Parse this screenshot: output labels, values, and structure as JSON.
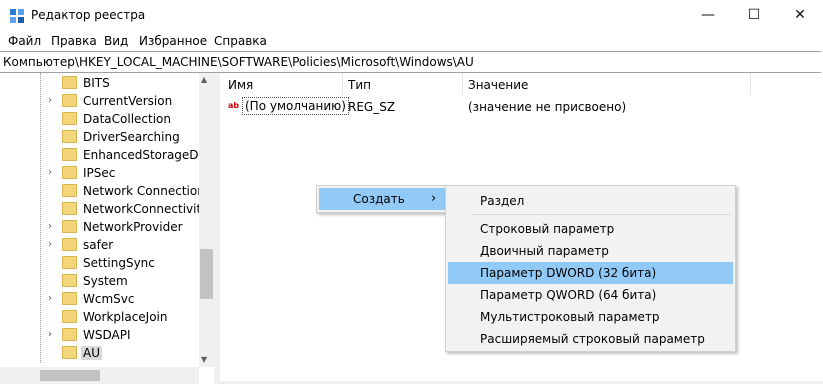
{
  "window": {
    "title": "Редактор реестра",
    "controls": {
      "minimize": "—",
      "maximize": "☐",
      "close": "✕"
    }
  },
  "menu": [
    "Файл",
    "Правка",
    "Вид",
    "Избранное",
    "Справка"
  ],
  "address": "Компьютер\\HKEY_LOCAL_MACHINE\\SOFTWARE\\Policies\\Microsoft\\Windows\\AU",
  "tree": [
    {
      "label": "BITS",
      "expandable": false
    },
    {
      "label": "CurrentVersion",
      "expandable": true
    },
    {
      "label": "DataCollection",
      "expandable": false
    },
    {
      "label": "DriverSearching",
      "expandable": false
    },
    {
      "label": "EnhancedStorageDevi",
      "expandable": false
    },
    {
      "label": "IPSec",
      "expandable": true
    },
    {
      "label": "Network Connections",
      "expandable": false
    },
    {
      "label": "NetworkConnectivityS",
      "expandable": false
    },
    {
      "label": "NetworkProvider",
      "expandable": true
    },
    {
      "label": "safer",
      "expandable": true
    },
    {
      "label": "SettingSync",
      "expandable": false
    },
    {
      "label": "System",
      "expandable": false
    },
    {
      "label": "WcmSvc",
      "expandable": true
    },
    {
      "label": "WorkplaceJoin",
      "expandable": false
    },
    {
      "label": "WSDAPI",
      "expandable": true
    },
    {
      "label": "AU",
      "expandable": false,
      "selected": true
    }
  ],
  "list": {
    "columns": [
      "Имя",
      "Тип",
      "Значение"
    ],
    "rows": [
      {
        "icon": "ab",
        "name": "(По умолчанию)",
        "type": "REG_SZ",
        "value": "(значение не присвоено)"
      }
    ]
  },
  "context_menu": {
    "create_label": "Создать",
    "arrow": "›"
  },
  "submenu": {
    "items": [
      {
        "label": "Раздел",
        "highlighted": false,
        "separator_after": true
      },
      {
        "label": "Строковый параметр",
        "highlighted": false
      },
      {
        "label": "Двоичный параметр",
        "highlighted": false
      },
      {
        "label": "Параметр DWORD (32 бита)",
        "highlighted": true
      },
      {
        "label": "Параметр QWORD (64 бита)",
        "highlighted": false
      },
      {
        "label": "Мультистроковый параметр",
        "highlighted": false
      },
      {
        "label": "Расширяемый строковый параметр",
        "highlighted": false
      }
    ]
  },
  "colors": {
    "highlight": "#91c9f7",
    "folder": "#f3d57a"
  },
  "icons": [
    "regedit-icon",
    "folder-icon",
    "string-value-icon",
    "chevron-right-icon"
  ]
}
